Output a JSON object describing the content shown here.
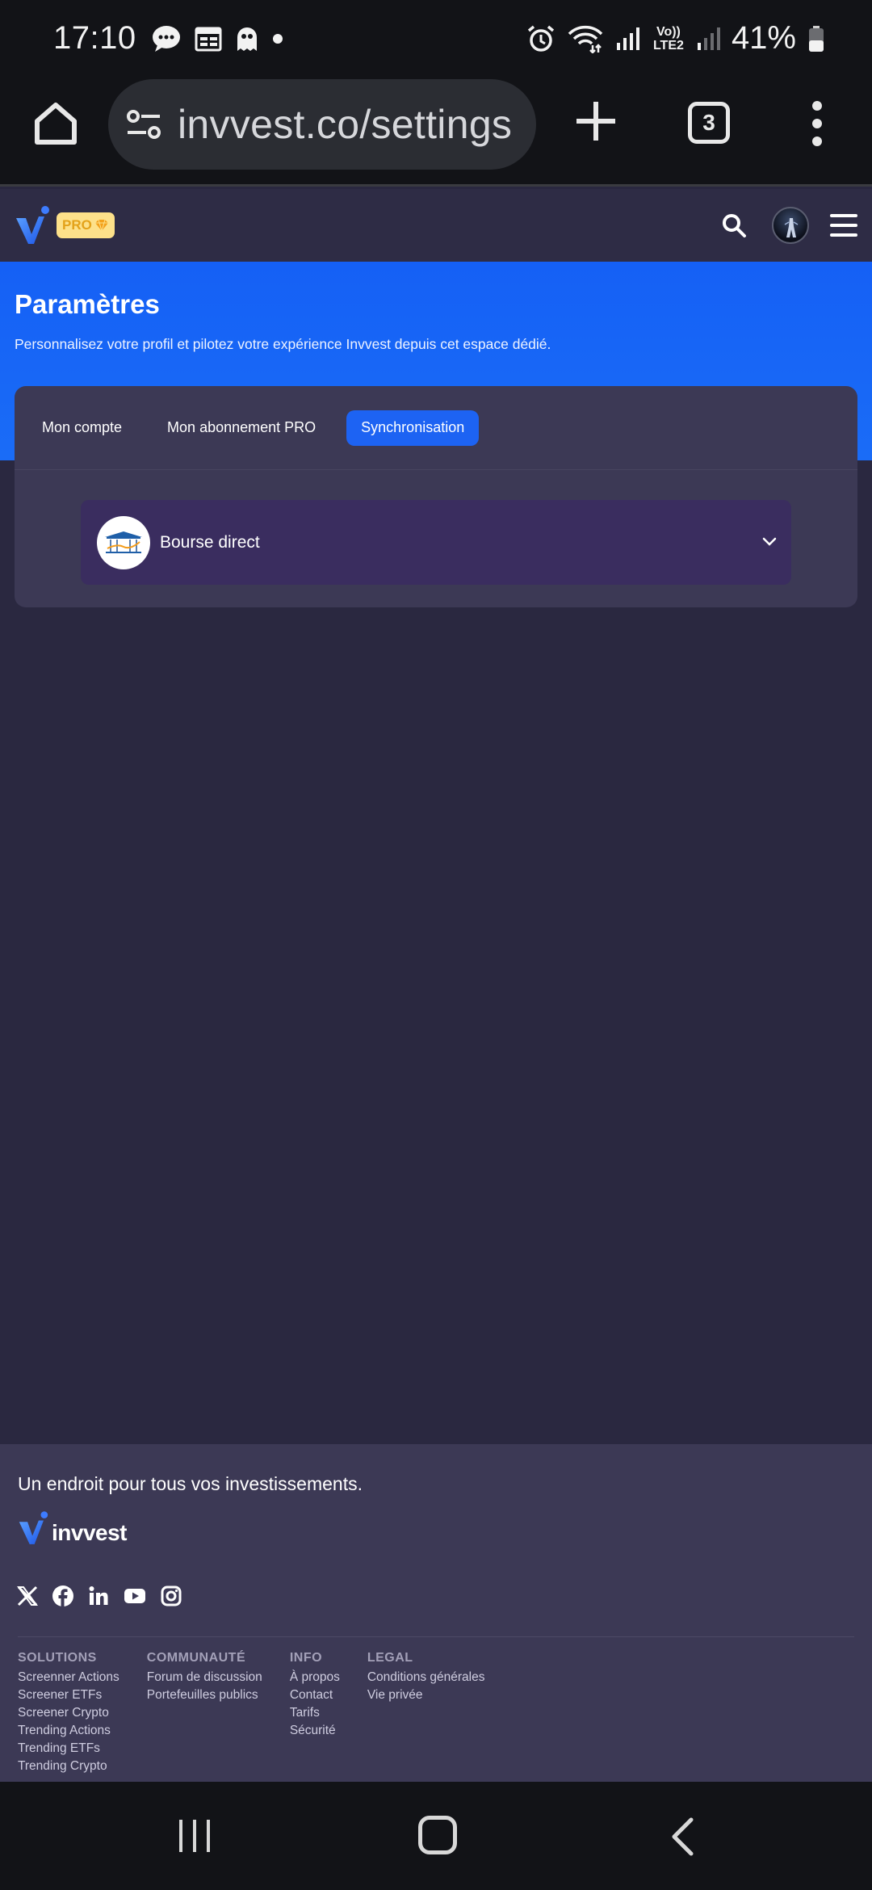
{
  "status_bar": {
    "time": "17:10",
    "network": "Vo)) LTE2",
    "battery": "41%"
  },
  "browser": {
    "url": "invvest.co/settings",
    "tab_count": "3"
  },
  "header": {
    "badge": "PRO"
  },
  "hero": {
    "title": "Paramètres",
    "subtitle": "Personnalisez votre profil et pilotez votre expérience Invvest depuis cet espace dédié."
  },
  "tabs": [
    {
      "label": "Mon compte",
      "active": false
    },
    {
      "label": "Mon abonnement PRO",
      "active": false
    },
    {
      "label": "Synchronisation",
      "active": true
    }
  ],
  "sync": {
    "broker_name": "Bourse direct"
  },
  "footer": {
    "tagline": "Un endroit pour tous vos investissements.",
    "brand": "invvest",
    "columns": [
      {
        "title": "SOLUTIONS",
        "links": [
          "Screenner Actions",
          "Screener ETFs",
          "Screener Crypto",
          "Trending Actions",
          "Trending ETFs",
          "Trending Crypto"
        ]
      },
      {
        "title": "COMMUNAUTÉ",
        "links": [
          "Forum de discussion",
          "Portefeuilles publics"
        ]
      },
      {
        "title": "INFO",
        "links": [
          "À propos",
          "Contact",
          "Tarifs",
          "Sécurité"
        ]
      },
      {
        "title": "LEGAL",
        "links": [
          "Conditions générales",
          "Vie privée"
        ]
      }
    ]
  },
  "colors": {
    "accent": "#1d63f3",
    "page_bg": "#2a2840",
    "card_bg": "#3c3955",
    "accordion_bg": "#3a2d5f",
    "pro_badge_bg": "#fde18a"
  },
  "icons": [
    "message-icon",
    "calendar-icon",
    "ghost-icon",
    "alarm-icon",
    "wifi-icon",
    "signal-icon",
    "battery-icon",
    "home-icon",
    "site-settings-icon",
    "plus-icon",
    "tabs-icon",
    "more-vert-icon",
    "search-icon",
    "avatar",
    "menu-icon",
    "chevron-down-icon",
    "x-icon",
    "facebook-icon",
    "linkedin-icon",
    "youtube-icon",
    "instagram-icon"
  ]
}
